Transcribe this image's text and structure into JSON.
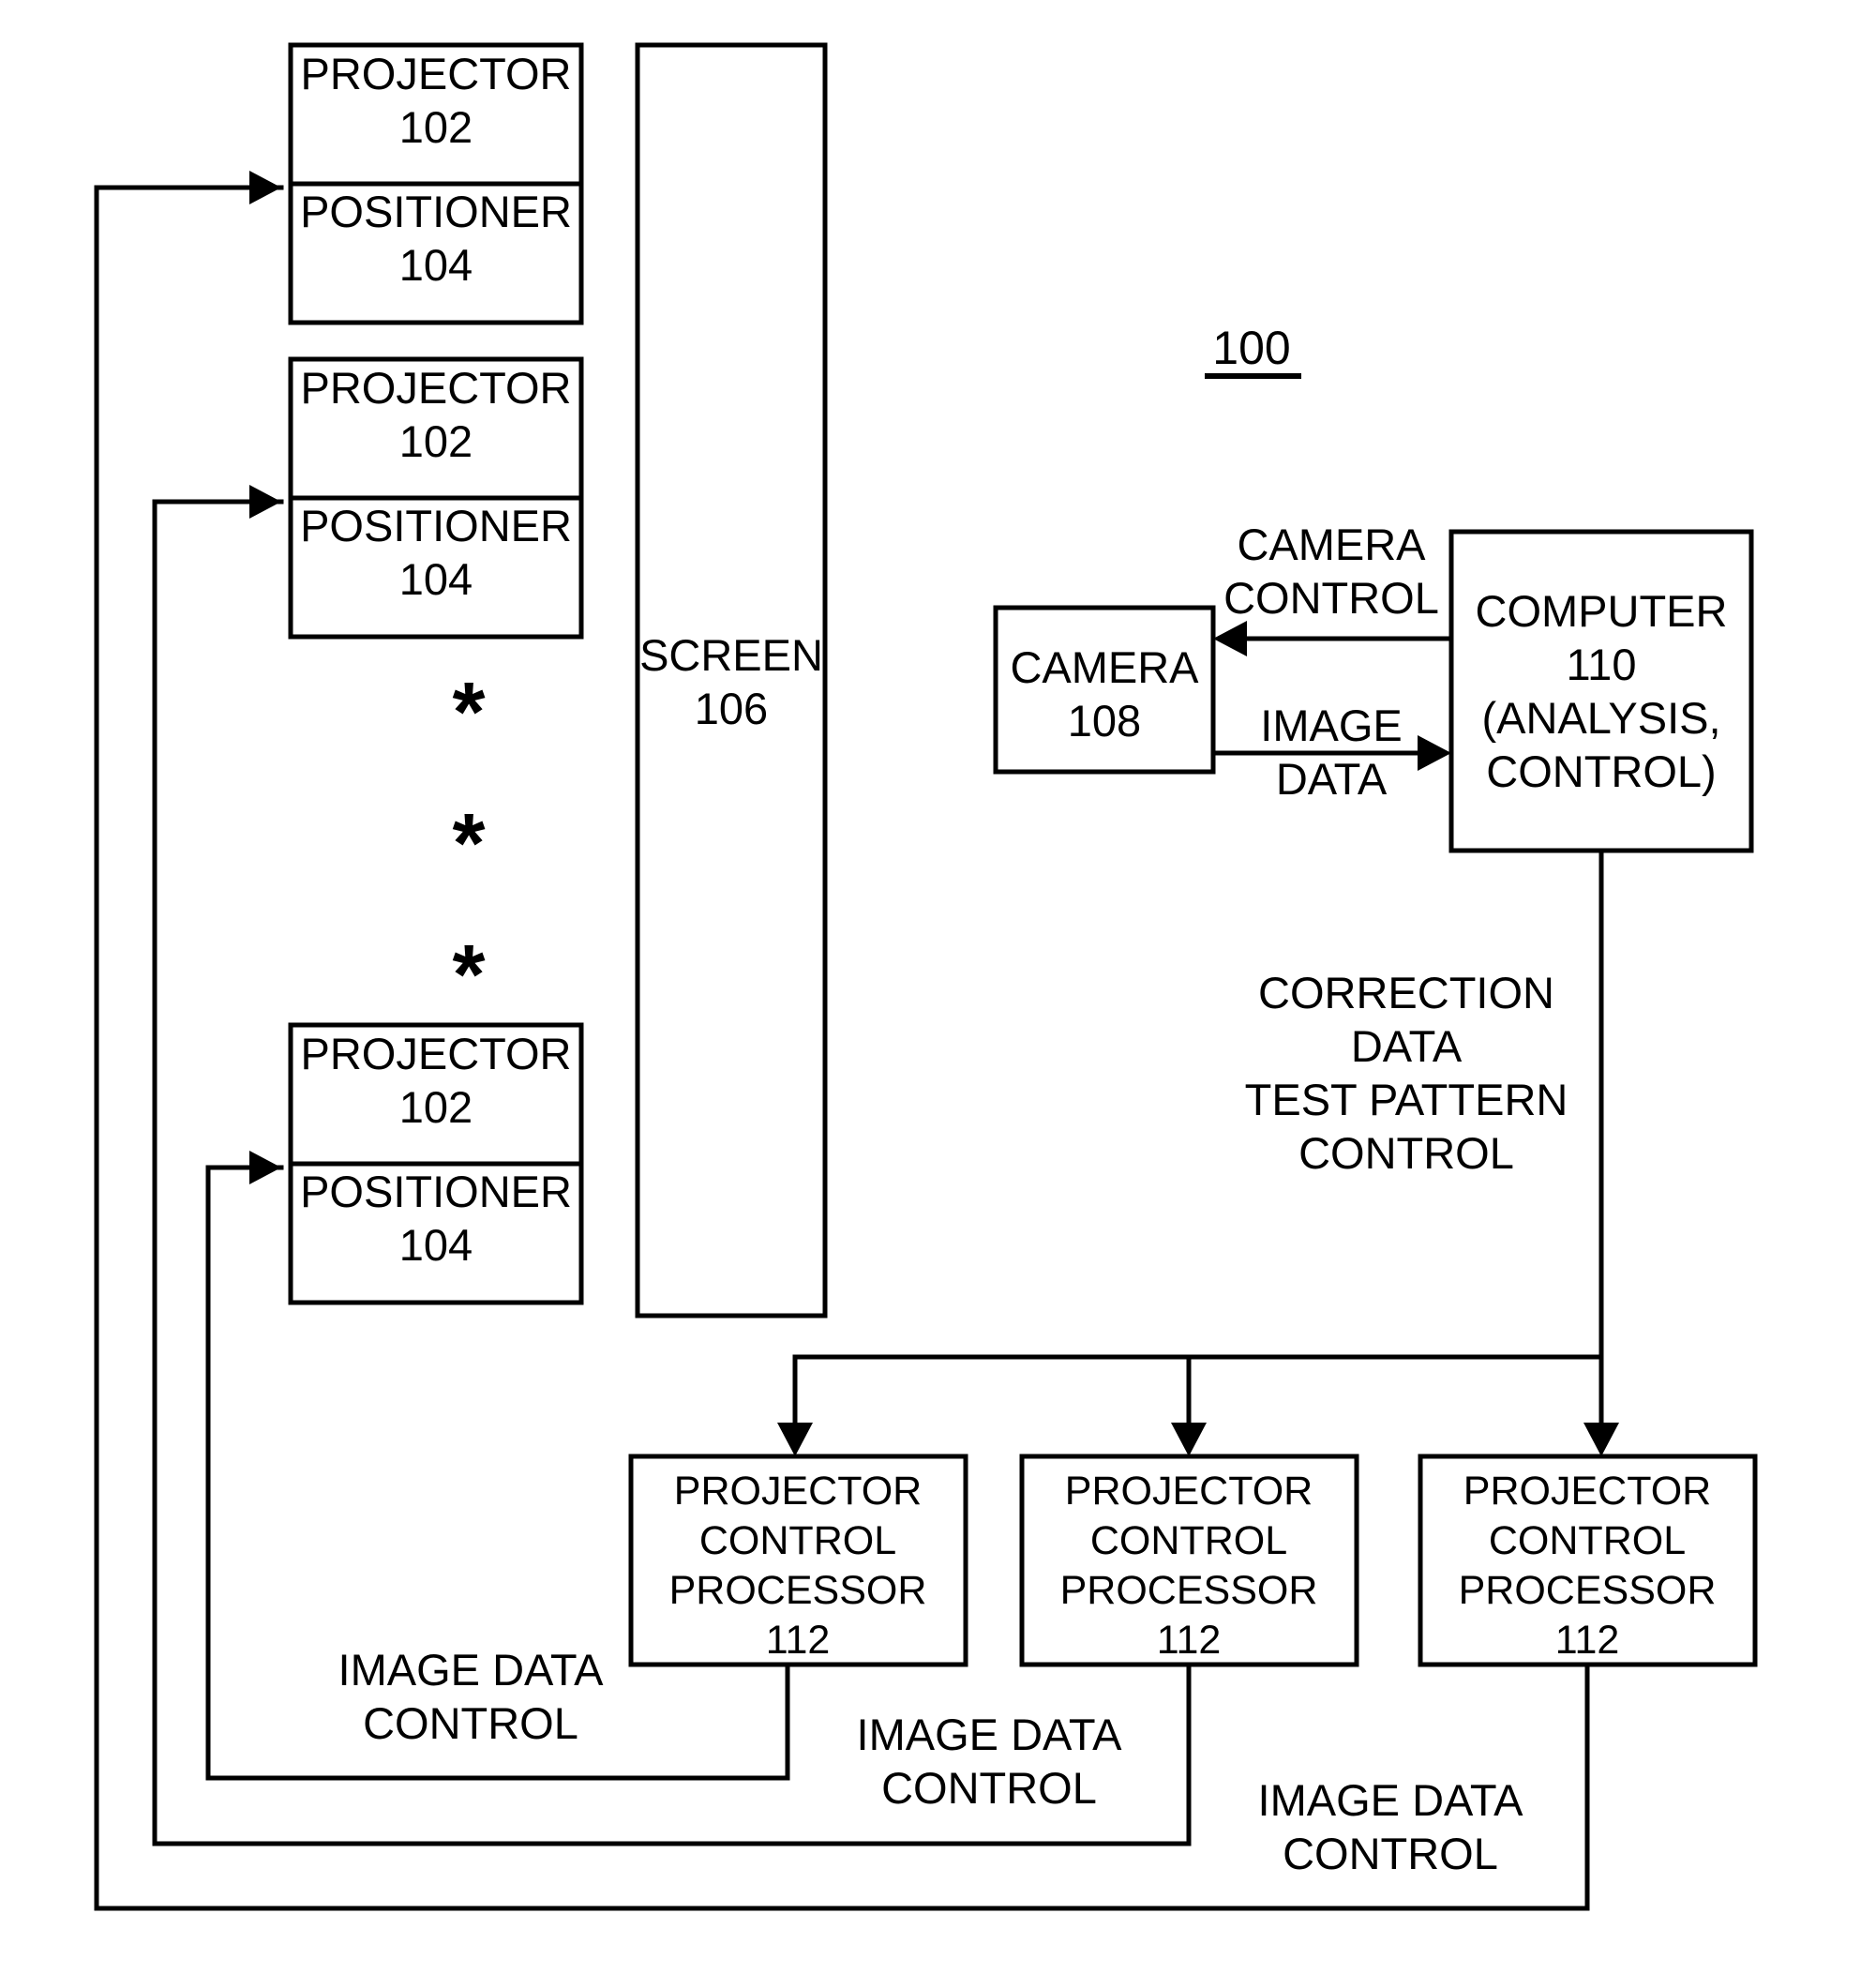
{
  "figure": {
    "number": "100",
    "underlined": true
  },
  "blocks": {
    "projector_1": {
      "title": "PROJECTOR",
      "ref": "102"
    },
    "positioner_1": {
      "title": "POSITIONER",
      "ref": "104"
    },
    "projector_2": {
      "title": "PROJECTOR",
      "ref": "102"
    },
    "positioner_2": {
      "title": "POSITIONER",
      "ref": "104"
    },
    "projector_3": {
      "title": "PROJECTOR",
      "ref": "102"
    },
    "positioner_3": {
      "title": "POSITIONER",
      "ref": "104"
    },
    "screen": {
      "title": "SCREEN",
      "ref": "106"
    },
    "camera": {
      "title": "CAMERA",
      "ref": "108"
    },
    "computer": {
      "line1": "COMPUTER",
      "line2": "110",
      "line3": "(ANALYSIS,",
      "line4": "CONTROL)"
    },
    "pcp_1": {
      "line1": "PROJECTOR",
      "line2": "CONTROL",
      "line3": "PROCESSOR",
      "ref": "112"
    },
    "pcp_2": {
      "line1": "PROJECTOR",
      "line2": "CONTROL",
      "line3": "PROCESSOR",
      "ref": "112"
    },
    "pcp_3": {
      "line1": "PROJECTOR",
      "line2": "CONTROL",
      "line3": "PROCESSOR",
      "ref": "112"
    }
  },
  "edge_labels": {
    "camera_control": {
      "line1": "CAMERA",
      "line2": "CONTROL"
    },
    "image_data": {
      "line1": "IMAGE",
      "line2": "DATA"
    },
    "correction": {
      "line1": "CORRECTION",
      "line2": "DATA",
      "line3": "TEST PATTERN",
      "line4": "CONTROL"
    },
    "image_data_control_1": {
      "line1": "IMAGE DATA",
      "line2": "CONTROL"
    },
    "image_data_control_2": {
      "line1": "IMAGE DATA",
      "line2": "CONTROL"
    },
    "image_data_control_3": {
      "line1": "IMAGE DATA",
      "line2": "CONTROL"
    }
  },
  "ellipsis": {
    "marker": "*",
    "count": 3
  },
  "colors": {
    "ink": "#000000",
    "paper": "#ffffff"
  }
}
